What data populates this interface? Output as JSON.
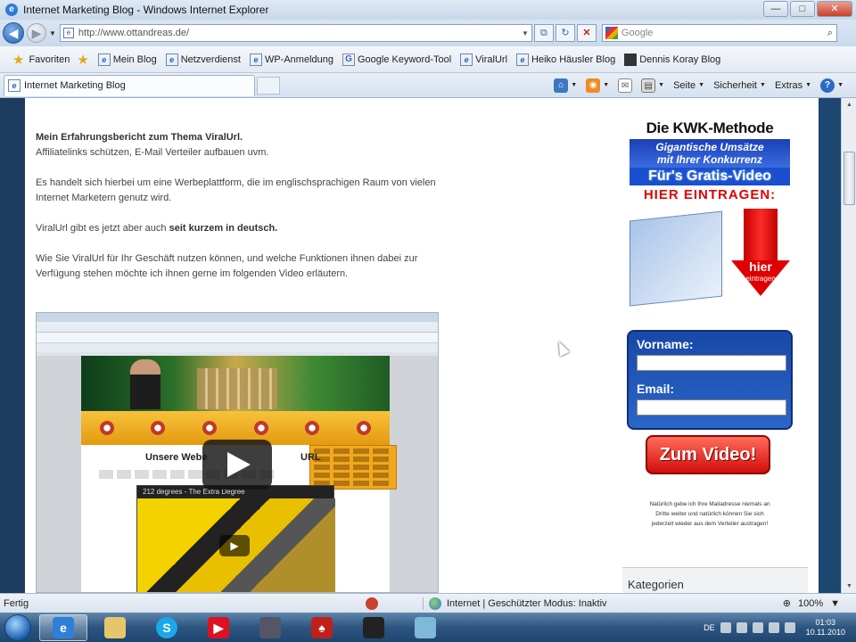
{
  "window": {
    "title": "Internet Marketing Blog - Windows Internet Explorer",
    "min": "—",
    "max": "□",
    "close": "✕"
  },
  "address": {
    "url": "http://www.ottandreas.de/",
    "search_placeholder": "Google"
  },
  "favorites": {
    "label": "Favoriten",
    "items": [
      "Mein Blog",
      "Netzverdienst",
      "WP-Anmeldung",
      "Google Keyword-Tool",
      "ViralUrl",
      "Heiko Häusler Blog",
      "Dennis Koray Blog"
    ]
  },
  "tab": {
    "title": "Internet Marketing Blog"
  },
  "commands": {
    "page": "Seite",
    "security": "Sicherheit",
    "extras": "Extras"
  },
  "post": {
    "p1_line1": "Mein Erfahrungsbericht zum Thema ViralUrl.",
    "p1_line2": "Affiliatelinks schützen, E-Mail Verteiler aufbauen uvm.",
    "p2": "Es handelt sich hierbei um eine Werbeplattform, die im englischsprachigen Raum von vielen Internet Marketern genutz wird.",
    "p3_a": "ViralUrl gibt es jetzt aber auch ",
    "p3_b": "seit kurzem in deutsch.",
    "p4": "Wie Sie ViralUrl für Ihr Geschäft nutzen können, und welche Funktionen ihnen dabei zur Verfügung stehen möchte ich ihnen gerne im folgenden Video erläutern."
  },
  "video": {
    "heading_left": "Unsere Webe",
    "heading_right": "URL",
    "inner_title": "212 degrees - The Extra Degree",
    "play_small": "▶"
  },
  "sidebar": {
    "kwk_title": "Die KWK-Methode",
    "kwk_sub1": "Gigantische Umsätze",
    "kwk_sub2": "mit Ihrer Konkurrenz",
    "kwk_video": "Für's Gratis-Video",
    "kwk_red": "HIER EINTRAGEN:",
    "kwk_hier": "hier",
    "kwk_eintragen": "eintragen",
    "vorname": "Vorname:",
    "email": "Email:",
    "cta": "Zum Video!",
    "note": "Natürlich gebe ich Ihre Mailadresse niemals an Dritte weiter und natürlich können Sie sich jederzeit wieder aus dem Verteiler austragen!",
    "categories": "Kategorien"
  },
  "status": {
    "done": "Fertig",
    "zone": "Internet | Geschützter Modus: Inaktiv",
    "zoom": "100%"
  },
  "taskbar": {
    "lang": "DE",
    "time": "01:03",
    "date": "10.11.2010"
  }
}
